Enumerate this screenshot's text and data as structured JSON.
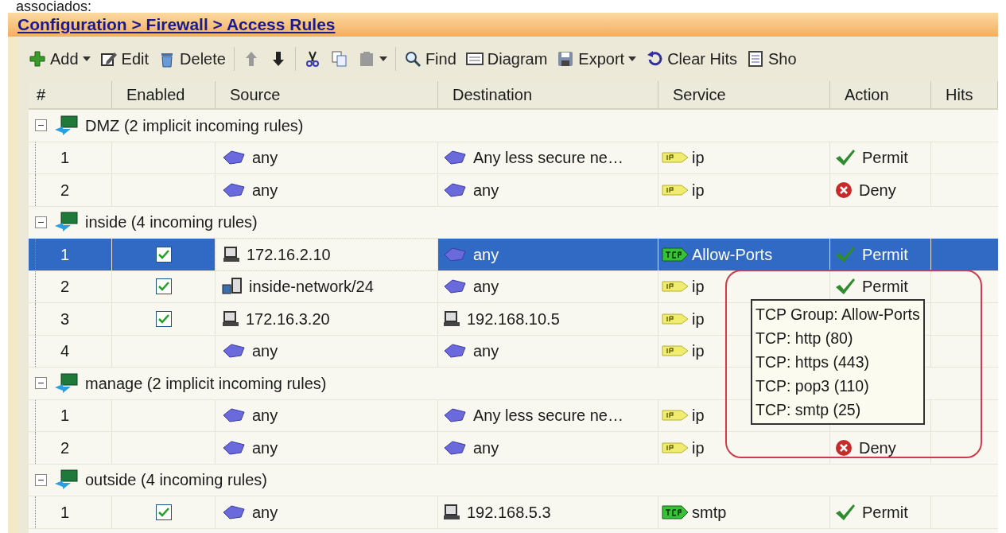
{
  "caption": "associados:",
  "breadcrumb": "Configuration > Firewall > Access Rules",
  "toolbar": [
    {
      "kind": "button",
      "label": "Add",
      "menu": true,
      "disabled": false
    },
    {
      "kind": "button",
      "label": "Edit",
      "menu": false,
      "disabled": false
    },
    {
      "kind": "button",
      "label": "Delete",
      "menu": false,
      "disabled": false
    },
    {
      "kind": "separator"
    },
    {
      "kind": "button",
      "menu": false,
      "disabled": true
    },
    {
      "kind": "button",
      "menu": false,
      "disabled": false
    },
    {
      "kind": "separator"
    },
    {
      "kind": "button",
      "menu": false,
      "disabled": false
    },
    {
      "kind": "button",
      "menu": false,
      "disabled": false
    },
    {
      "kind": "button",
      "menu": true,
      "disabled": true
    },
    {
      "kind": "separator"
    },
    {
      "kind": "button",
      "label": "Find",
      "menu": false,
      "disabled": false
    },
    {
      "kind": "button",
      "label": "Diagram",
      "menu": false,
      "disabled": false
    },
    {
      "kind": "button",
      "label": "Export",
      "menu": true,
      "disabled": false
    },
    {
      "kind": "button",
      "label": "Clear Hits",
      "menu": false,
      "disabled": false
    },
    {
      "kind": "button",
      "label": "Sho",
      "menu": false,
      "disabled": false
    }
  ],
  "table": {
    "columns": [
      "#",
      "Enabled",
      "Source",
      "Destination",
      "Service",
      "Action",
      "Hits"
    ],
    "groups": [
      {
        "label": "DMZ (2 implicit incoming rules)",
        "expanded": true,
        "rows": [
          {
            "number": "1",
            "selected": false,
            "source": {
              "kind": "network",
              "text": "any"
            },
            "destination": {
              "kind": "network",
              "text": "Any less secure ne…"
            },
            "service": {
              "kind": "ip",
              "text": "ip"
            },
            "action": {
              "kind": "permit",
              "text": "Permit"
            }
          },
          {
            "number": "2",
            "selected": false,
            "source": {
              "kind": "network",
              "text": "any"
            },
            "destination": {
              "kind": "network",
              "text": "any"
            },
            "service": {
              "kind": "ip",
              "text": "ip"
            },
            "action": {
              "kind": "deny",
              "text": "Deny"
            }
          }
        ]
      },
      {
        "label": "inside (4 incoming rules)",
        "expanded": true,
        "rows": [
          {
            "number": "1",
            "selected": true,
            "enabled": true,
            "source": {
              "kind": "host",
              "text": "172.16.2.10",
              "focused": true
            },
            "destination": {
              "kind": "network",
              "text": "any"
            },
            "service": {
              "kind": "tcp",
              "text": "Allow-Ports"
            },
            "action": {
              "kind": "permit",
              "text": "Permit"
            }
          },
          {
            "number": "2",
            "selected": false,
            "enabled": true,
            "source": {
              "kind": "netgroup",
              "text": "inside-network/24"
            },
            "destination": {
              "kind": "network",
              "text": "any"
            },
            "service": {
              "kind": "ip",
              "text": "ip"
            },
            "action": {
              "kind": "permit",
              "text": "Permit"
            }
          },
          {
            "number": "3",
            "selected": false,
            "enabled": true,
            "source": {
              "kind": "host",
              "text": "172.16.3.20"
            },
            "destination": {
              "kind": "host",
              "text": "192.168.10.5"
            },
            "service": {
              "kind": "ip",
              "text": "ip"
            }
          },
          {
            "number": "4",
            "selected": false,
            "source": {
              "kind": "network",
              "text": "any"
            },
            "destination": {
              "kind": "network",
              "text": "any"
            },
            "service": {
              "kind": "ip",
              "text": "ip"
            }
          }
        ]
      },
      {
        "label": "manage (2 implicit incoming rules)",
        "expanded": true,
        "rows": [
          {
            "number": "1",
            "selected": false,
            "source": {
              "kind": "network",
              "text": "any"
            },
            "destination": {
              "kind": "network",
              "text": "Any less secure ne…"
            },
            "service": {
              "kind": "ip",
              "text": "ip"
            }
          },
          {
            "number": "2",
            "selected": false,
            "source": {
              "kind": "network",
              "text": "any"
            },
            "destination": {
              "kind": "network",
              "text": "any"
            },
            "service": {
              "kind": "ip",
              "text": "ip"
            },
            "action": {
              "kind": "deny",
              "text": "Deny"
            }
          }
        ]
      },
      {
        "label": "outside (4 incoming rules)",
        "expanded": true,
        "rows": [
          {
            "number": "1",
            "selected": false,
            "enabled": true,
            "source": {
              "kind": "network",
              "text": "any"
            },
            "destination": {
              "kind": "host",
              "text": "192.168.5.3"
            },
            "service": {
              "kind": "tcp",
              "text": "smtp"
            },
            "action": {
              "kind": "permit",
              "text": "Permit"
            }
          }
        ]
      }
    ]
  },
  "tooltip": {
    "lines": [
      "TCP Group: Allow-Ports",
      "TCP: http (80)",
      "TCP: https (443)",
      "TCP: pop3 (110)",
      "TCP: smtp (25)"
    ]
  },
  "highlight": true
}
